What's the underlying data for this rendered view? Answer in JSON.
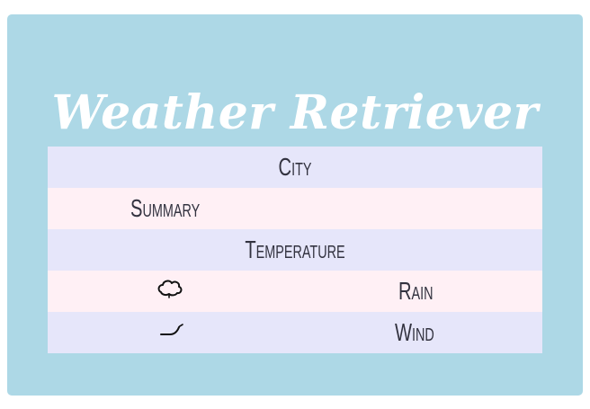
{
  "app": {
    "title": "Weather Retriever"
  },
  "weather_table": {
    "city_label": "City",
    "summary_label": "Summary",
    "temperature_label": "Temperature",
    "rain_label": "Rain",
    "wind_label": "Wind",
    "rain_icon": "cloud-icon",
    "wind_icon": "wind-icon"
  },
  "colors": {
    "background": "#add8e6",
    "title": "#ffffff",
    "row_lavender": "#e6e6fa",
    "row_pink": "#fff0f5",
    "text": "#333340"
  }
}
